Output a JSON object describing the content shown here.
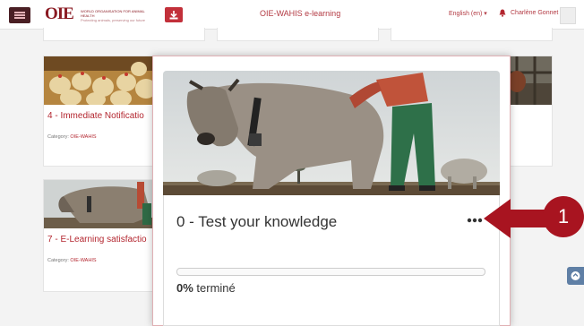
{
  "header": {
    "logo_text": "OIE",
    "logo_tagline": "WORLD ORGANISATION FOR ANIMAL HEALTH",
    "logo_subtagline": "Protecting animals, preserving our future",
    "app_title": "OIE-WAHIS e-learning",
    "language": "English (en) ▾",
    "user_name": "Charlène Gonnet",
    "icons": {
      "menu": "hamburger-icon",
      "download": "download-icon",
      "notifications": "bell-icon",
      "avatar": "user-avatar-icon"
    }
  },
  "courses": [
    {
      "title": "4 - Immediate Notificatio",
      "category_label": "Category:",
      "category": "OIE-WAHIS"
    },
    {
      "title": "7 - E-Learning satisfactio",
      "category_label": "Category:",
      "category": "OIE-WAHIS"
    }
  ],
  "highlight_course": {
    "title": "0 - Test your knowledge",
    "progress_percent": 0,
    "progress_value": "0%",
    "progress_label": "terminé"
  },
  "callout": {
    "number": "1"
  },
  "colors": {
    "brand": "#8a1a22",
    "accent": "#c2303a",
    "callout": "#a81420"
  }
}
